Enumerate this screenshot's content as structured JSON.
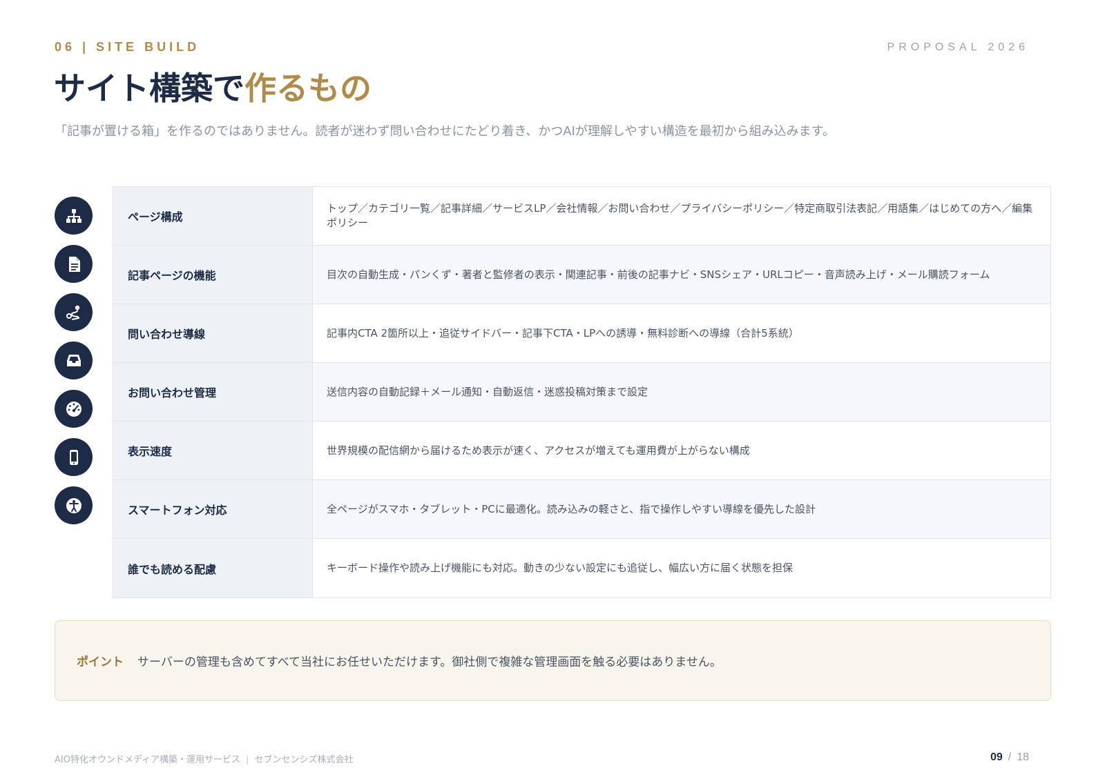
{
  "header": {
    "section_label": "06 | SITE BUILD",
    "proposal": "PROPOSAL 2026",
    "title_main": "サイト構築で",
    "title_accent": "作るもの",
    "subtitle": "「記事が置ける箱」を作るのではありません。読者が迷わず問い合わせにたどり着き、かつAIが理解しやすい構造を最初から組み込みます。"
  },
  "rows": [
    {
      "icon": "sitemap-icon",
      "label": "ページ構成",
      "desc": "トップ／カテゴリ一覧／記事詳細／サービスLP／会社情報／お問い合わせ／プライバシーポリシー／特定商取引法表記／用語集／はじめての方へ／編集ポリシー"
    },
    {
      "icon": "document-icon",
      "label": "記事ページの機能",
      "desc": "目次の自動生成・パンくず・著者と監修者の表示・関連記事・前後の記事ナビ・SNSシェア・URLコピー・音声読み上げ・メール購読フォーム"
    },
    {
      "icon": "route-icon",
      "label": "問い合わせ導線",
      "desc": "記事内CTA 2箇所以上・追従サイドバー・記事下CTA・LPへの誘導・無料診断への導線（合計5系統）"
    },
    {
      "icon": "inbox-icon",
      "label": "お問い合わせ管理",
      "desc": "送信内容の自動記録＋メール通知・自動返信・迷惑投稿対策まで設定"
    },
    {
      "icon": "speedometer-icon",
      "label": "表示速度",
      "desc": "世界規模の配信網から届けるため表示が速く、アクセスが増えても運用費が上がらない構成"
    },
    {
      "icon": "smartphone-icon",
      "label": "スマートフォン対応",
      "desc": "全ページがスマホ・タブレット・PCに最適化。読み込みの軽さと、指で操作しやすい導線を優先した設計"
    },
    {
      "icon": "accessibility-icon",
      "label": "誰でも読める配慮",
      "desc": "キーボード操作や読み上げ機能にも対応。動きの少ない設定にも追従し、幅広い方に届く状態を担保"
    }
  ],
  "point": {
    "label": "ポイント",
    "text": "サーバーの管理も含めてすべて当社にお任せいただけます。御社側で複雑な管理画面を触る必要はありません。"
  },
  "footer": {
    "service": "AIO特化オウンドメディア構築・運用サービス",
    "separator": "|",
    "company": "セブンセンシズ株式会社",
    "page_current": "09",
    "page_sep": "/",
    "page_total": "18"
  },
  "colors": {
    "navy": "#1e2b47",
    "gold": "#b08a4a",
    "label_bg": "#eef2f7",
    "point_bg": "#f8f5ec"
  }
}
